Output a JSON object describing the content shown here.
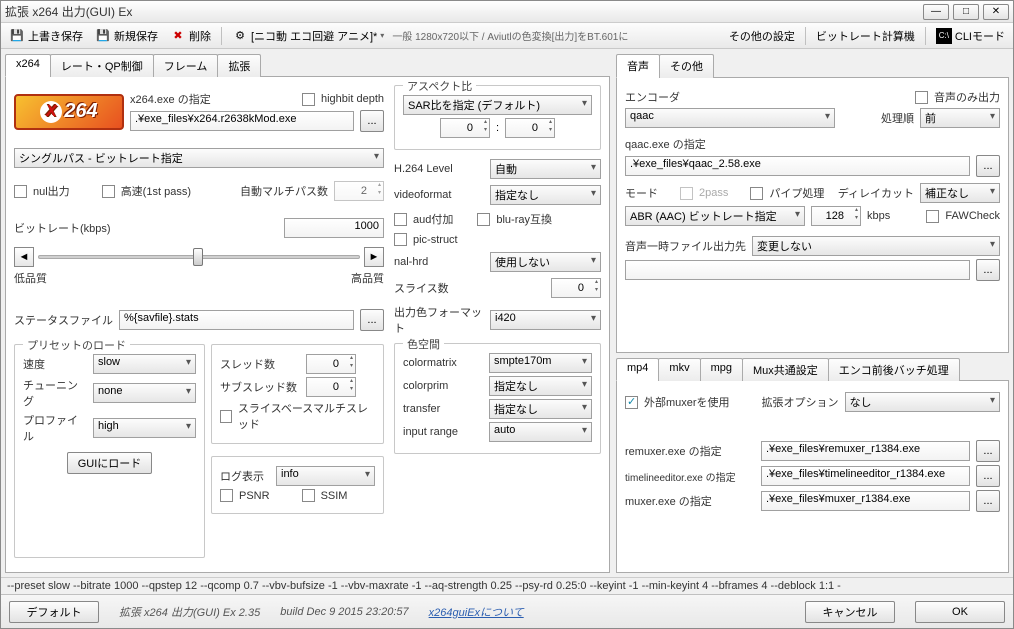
{
  "window": {
    "title": "拡張 x264 出力(GUI) Ex"
  },
  "toolbar": {
    "overwrite_save": "上書き保存",
    "new_save": "新規保存",
    "delete": "削除",
    "profile": "[ニコ動 エコ回避 アニメ]*",
    "profile_note": "一般 1280x720以下 / Aviutlの色変換[出力]をBT.601に",
    "other_settings": "その他の設定",
    "bitrate_calc": "ビットレート計算機",
    "cli_mode": "CLIモード"
  },
  "tabs_left": [
    "x264",
    "レート・QP制御",
    "フレーム",
    "拡張"
  ],
  "x264": {
    "exe_label": "x264.exe の指定",
    "highbit": "highbit depth",
    "exe_path": ".¥exe_files¥x264.r2638kMod.exe",
    "rc_mode": "シングルパス - ビットレート指定",
    "nul": "nul出力",
    "fast1st": "高速(1st pass)",
    "auto_multipass_label": "自動マルチパス数",
    "auto_multipass": "2",
    "bitrate_label": "ビットレート(kbps)",
    "bitrate": "1000",
    "low_q": "低品質",
    "high_q": "高品質",
    "status_file_label": "ステータスファイル",
    "status_file": "%{savfile}.stats"
  },
  "preset": {
    "legend": "プリセットのロード",
    "speed_label": "速度",
    "speed": "slow",
    "tuning_label": "チューニング",
    "tuning": "none",
    "profile_label": "プロファイル",
    "profile": "high",
    "gui_load": "GUIにロード"
  },
  "threads": {
    "threads_label": "スレッド数",
    "threads": "0",
    "subthreads_label": "サブスレッド数",
    "subthreads": "0",
    "slice_multi": "スライスベースマルチスレッド"
  },
  "log": {
    "log_label": "ログ表示",
    "log": "info",
    "psnr": "PSNR",
    "ssim": "SSIM"
  },
  "aspect": {
    "legend": "アスペクト比",
    "mode": "SAR比を指定 (デフォルト)",
    "sar_x": "0",
    "sar_y": "0"
  },
  "video": {
    "h264level_label": "H.264 Level",
    "h264level": "自動",
    "videoformat_label": "videoformat",
    "videoformat": "指定なし",
    "aud": "aud付加",
    "bluray": "blu-ray互換",
    "picstruct": "pic-struct",
    "nalhrd_label": "nal-hrd",
    "nalhrd": "使用しない",
    "slice_label": "スライス数",
    "slice": "0",
    "outfmt_label": "出力色フォーマット",
    "outfmt": "i420"
  },
  "color": {
    "legend": "色空間",
    "colormatrix_label": "colormatrix",
    "colormatrix": "smpte170m",
    "colorprim_label": "colorprim",
    "colorprim": "指定なし",
    "transfer_label": "transfer",
    "transfer": "指定なし",
    "inputrange_label": "input range",
    "inputrange": "auto"
  },
  "tabs_audio": [
    "音声",
    "その他"
  ],
  "audio": {
    "encoder_label": "エンコーダ",
    "audio_only": "音声のみ出力",
    "encoder": "qaac",
    "order_label": "処理順",
    "order": "前",
    "exe_label": "qaac.exe の指定",
    "exe_path": ".¥exe_files¥qaac_2.58.exe",
    "mode_label": "モード",
    "twopass": "2pass",
    "pipe": "パイプ処理",
    "delaycut_label": "ディレイカット",
    "delaycut": "補正なし",
    "mode": "ABR (AAC) ビットレート指定",
    "bitrate": "128",
    "kbps": "kbps",
    "fawcheck": "FAWCheck",
    "tempfile_label": "音声一時ファイル出力先",
    "tempfile": "変更しない",
    "tempfile_path": ""
  },
  "tabs_mux": [
    "mp4",
    "mkv",
    "mpg",
    "Mux共通設定",
    "エンコ前後バッチ処理"
  ],
  "mux": {
    "use_ext": "外部muxerを使用",
    "ext_opt_label": "拡張オプション",
    "ext_opt": "なし",
    "remuxer_label": "remuxer.exe の指定",
    "remuxer": ".¥exe_files¥remuxer_r1384.exe",
    "tleditor_label": "timelineeditor.exe の指定",
    "tleditor": ".¥exe_files¥timelineeditor_r1384.exe",
    "muxer_label": "muxer.exe の指定",
    "muxer": ".¥exe_files¥muxer_r1384.exe"
  },
  "cmdline": "--preset slow --bitrate 1000 --qpstep 12 --qcomp 0.7 --vbv-bufsize -1 --vbv-maxrate -1 --aq-strength 0.25 --psy-rd 0.25:0 --keyint -1 --min-keyint 4 --bframes 4 --deblock 1:1 -",
  "footer": {
    "default": "デフォルト",
    "version": "拡張 x264 出力(GUI) Ex 2.35",
    "build": "build Dec  9 2015 23:20:57",
    "about": "x264guiExについて",
    "cancel": "キャンセル",
    "ok": "OK"
  }
}
